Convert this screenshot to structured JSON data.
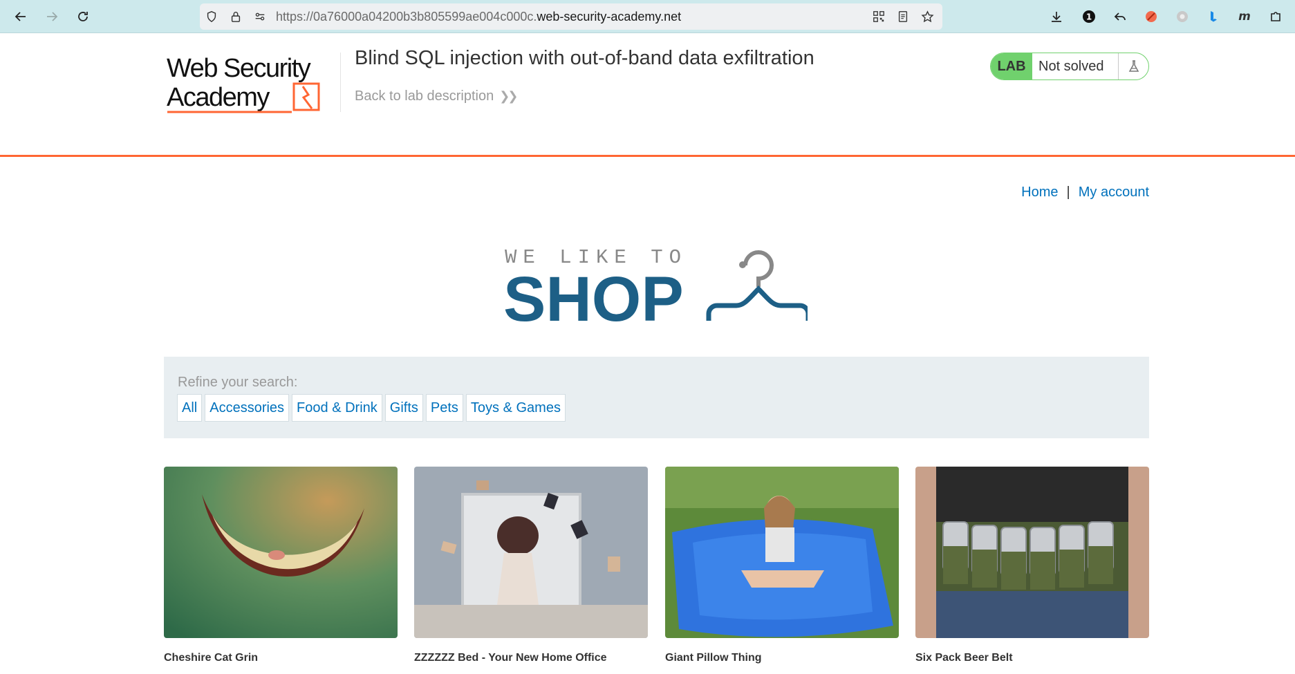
{
  "browser": {
    "url_prefix": "https://0a76000a04200b3b805599ae004c000c.",
    "url_host": "web-security-academy.net"
  },
  "lab": {
    "logo_line1": "Web Security",
    "logo_line2": "Academy",
    "title": "Blind SQL injection with out-of-band data exfiltration",
    "back_link": "Back to lab description",
    "badge": "LAB",
    "status": "Not solved"
  },
  "nav": {
    "home": "Home",
    "separator": "|",
    "account": "My account"
  },
  "shop_logo": {
    "top": "WE LIKE TO",
    "bottom": "SHOP"
  },
  "filters": {
    "label": "Refine your search:",
    "items": [
      "All",
      "Accessories",
      "Food & Drink",
      "Gifts",
      "Pets",
      "Toys & Games"
    ]
  },
  "products": [
    {
      "name": "Cheshire Cat Grin"
    },
    {
      "name": "ZZZZZZ Bed - Your New Home Office"
    },
    {
      "name": "Giant Pillow Thing"
    },
    {
      "name": "Six Pack Beer Belt"
    }
  ],
  "colors": {
    "accent": "#ff6633",
    "link": "#0071bc",
    "lab_green": "#70d16d",
    "shop_blue": "#1d5f86"
  }
}
